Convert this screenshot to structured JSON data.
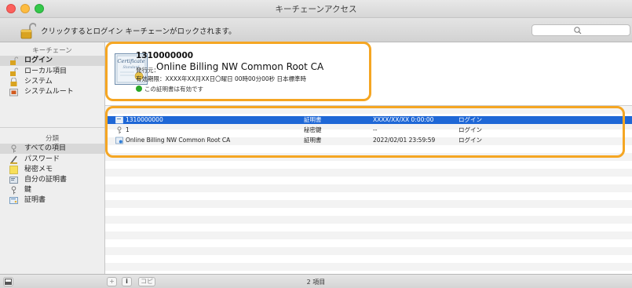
{
  "window": {
    "title": "キーチェーンアクセス"
  },
  "toolbar": {
    "lock_label": "クリックするとログイン キーチェーンがロックされます。",
    "search_placeholder": ""
  },
  "sidebar": {
    "keychains_header": "キーチェーン",
    "keychains": [
      {
        "label": "ログイン",
        "icon": "unlocked-padlock-icon",
        "selected": true
      },
      {
        "label": "ローカル項目",
        "icon": "unlocked-padlock-icon",
        "selected": false
      },
      {
        "label": "システム",
        "icon": "locked-padlock-icon",
        "selected": false
      },
      {
        "label": "システムルート",
        "icon": "folder-icon",
        "selected": false
      }
    ],
    "categories_header": "分類",
    "categories": [
      {
        "label": "すべての項目",
        "icon": "all-items-icon",
        "selected": true
      },
      {
        "label": "パスワード",
        "icon": "password-icon",
        "selected": false
      },
      {
        "label": "秘密メモ",
        "icon": "secure-note-icon",
        "selected": false
      },
      {
        "label": "自分の証明書",
        "icon": "my-certificate-icon",
        "selected": false
      },
      {
        "label": "鍵",
        "icon": "key-icon",
        "selected": false
      },
      {
        "label": "証明書",
        "icon": "certificate-icon",
        "selected": false
      }
    ]
  },
  "detail": {
    "name": "1310000000",
    "issuer_label": "発行元：",
    "issuer": "Online Billing NW Common Root CA",
    "expiry": "有効期限：XXXX年XX月XX日〇曜日 00時00分00秒 日本標準時",
    "valid": "この証明書は有効です"
  },
  "list": {
    "rows": [
      {
        "name": "1310000000",
        "kind": "証明書",
        "expires": "XXXX/XX/XX 0:00:00",
        "keychain": "ログイン",
        "icon": "certificate-icon",
        "selected": true
      },
      {
        "name": "1",
        "kind": "秘密鍵",
        "expires": "--",
        "keychain": "ログイン",
        "icon": "key-icon",
        "selected": false
      },
      {
        "name": "Online Billing NW Common Root CA",
        "kind": "証明書",
        "expires": "2022/02/01 23:59:59",
        "keychain": "ログイン",
        "icon": "certificate-icon",
        "selected": false
      }
    ]
  },
  "bottombar": {
    "add": "+",
    "info": "i",
    "copy": "コピー",
    "count": "2 項目"
  },
  "colors": {
    "selection": "#1e67d6",
    "highlight": "#f5a623",
    "valid_check": "#2aa72a"
  }
}
